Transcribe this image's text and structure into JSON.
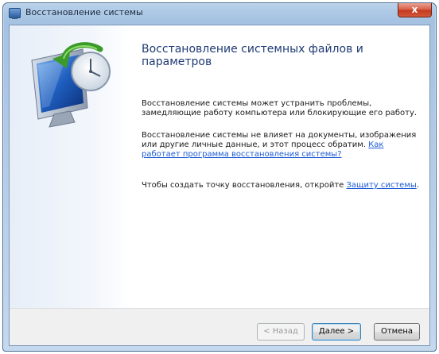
{
  "window": {
    "title": "Восстановление системы",
    "close_label": "x"
  },
  "main": {
    "heading": "Восстановление системных файлов и параметров",
    "para1": "Восстановление системы может устранить проблемы, замедляющие работу компьютера или блокирующие его работу.",
    "para2_text": "Восстановление системы не влияет на документы, изображения или другие личные данные, и этот процесс обратим. ",
    "para2_link": "Как работает программа восстановления системы?",
    "para3_text": "Чтобы создать точку восстановления, откройте ",
    "para3_link": "Защиту системы",
    "para3_end": "."
  },
  "footer": {
    "back_label": "< Назад",
    "back_hotkey": "Н",
    "next_label": "Далее >",
    "next_hotkey": "Д",
    "cancel_label": "Отмена"
  },
  "colors": {
    "heading": "#1f3b74",
    "link": "#1c5bd6",
    "close_button": "#c3391f"
  },
  "icons": [
    "system-restore-icon",
    "close-icon",
    "window-icon"
  ]
}
